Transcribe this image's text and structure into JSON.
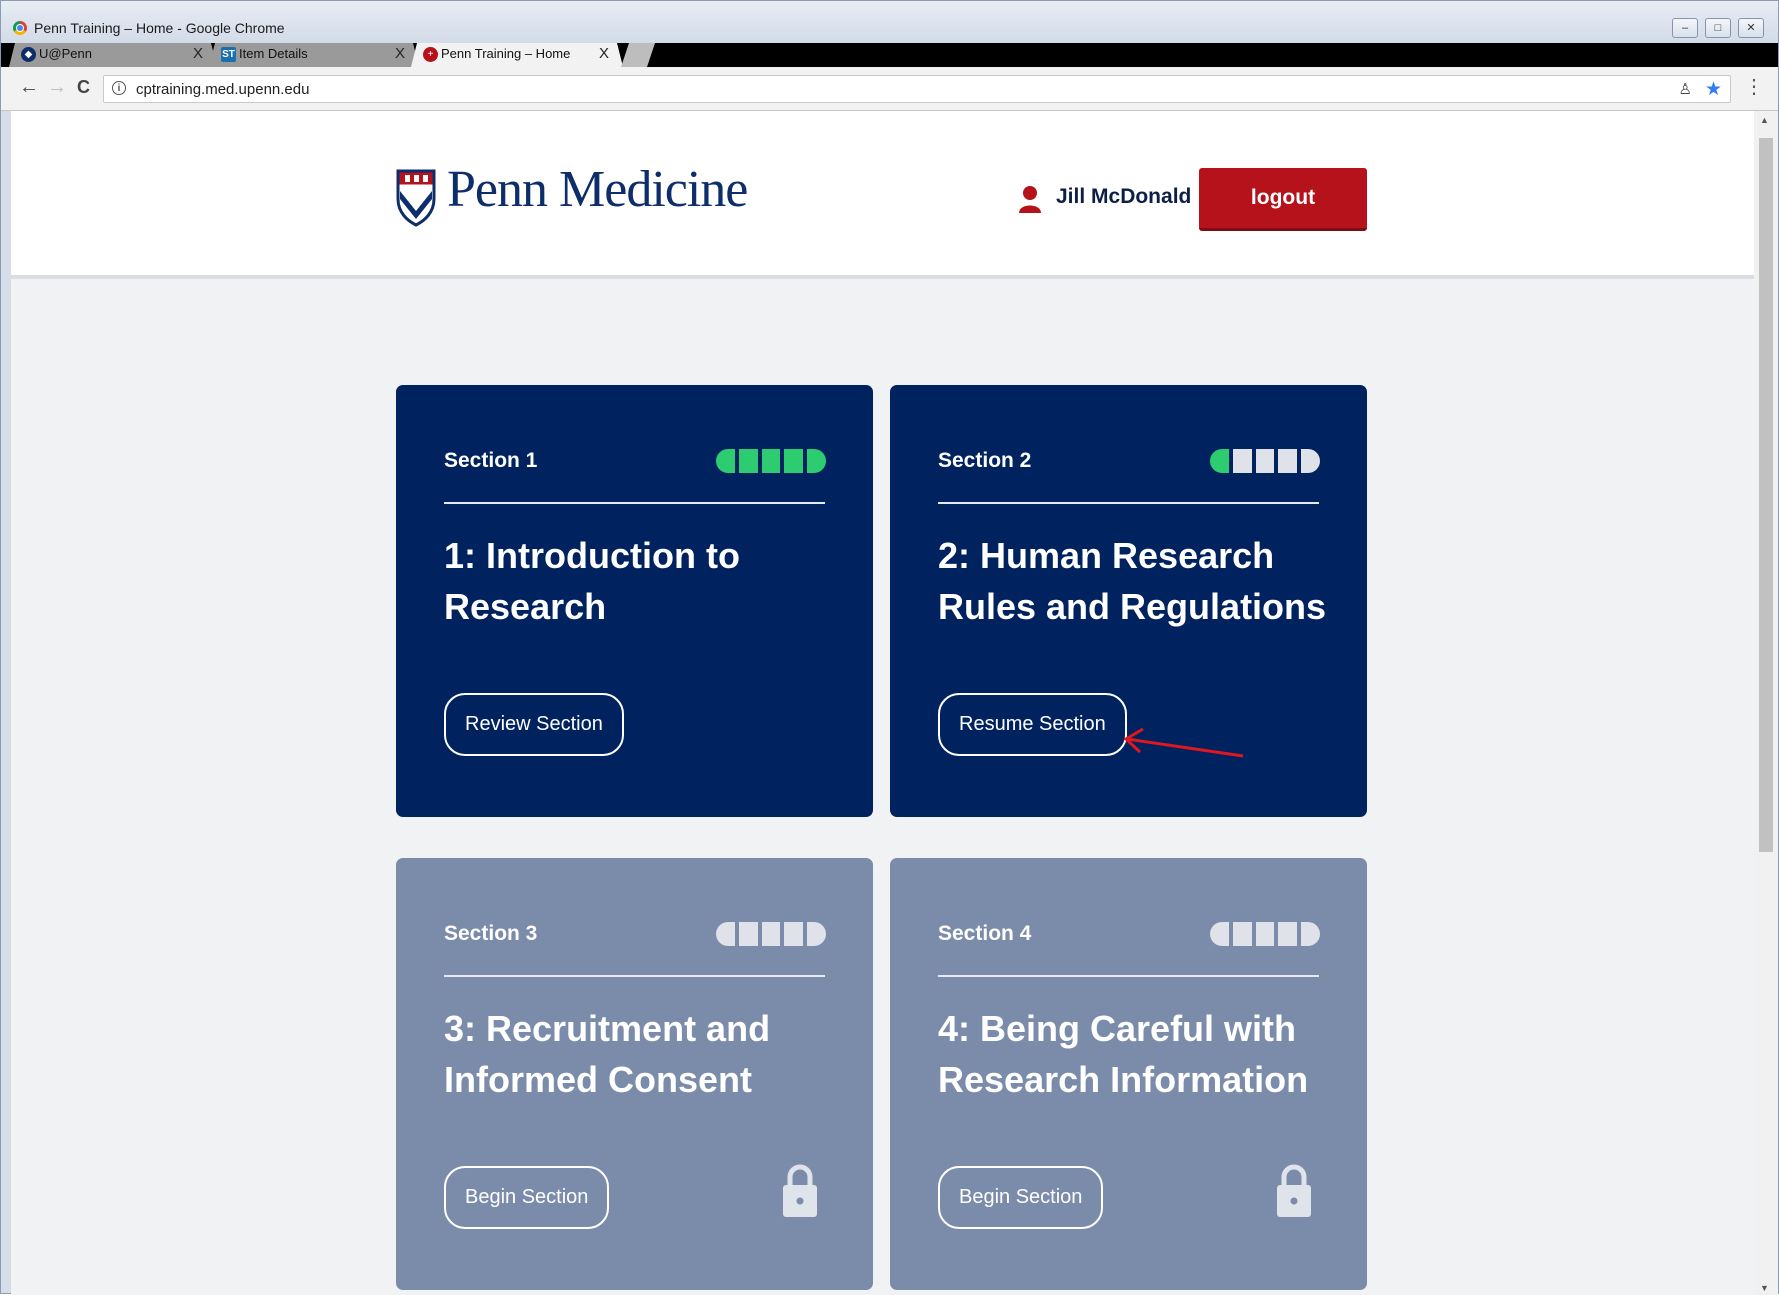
{
  "window": {
    "title": "Penn Training – Home - Google Chrome",
    "controls": {
      "minimize": "–",
      "maximize": "□",
      "close": "✕"
    }
  },
  "tabs": [
    {
      "label": "U@Penn",
      "close": "X",
      "icon": "penn-shield-icon"
    },
    {
      "label": "Item Details",
      "close": "X",
      "icon_text": "ST"
    },
    {
      "label": "Penn Training – Home",
      "close": "X",
      "icon": "plus-icon"
    }
  ],
  "toolbar": {
    "back": "←",
    "forward": "→",
    "reload": "C",
    "info": "i",
    "url": "cptraining.med.upenn.edu",
    "key": "♙",
    "star": "★",
    "menu": "⋮"
  },
  "header": {
    "brand": "Penn Medicine",
    "username": "Jill McDonald",
    "logout": "logout"
  },
  "sections": [
    {
      "label": "Section 1",
      "title": "1: Introduction to Research",
      "button": "Review Section",
      "progress_done": 5,
      "progress_total": 5,
      "locked": false
    },
    {
      "label": "Section 2",
      "title": "2: Human Research Rules and Regulations",
      "button": "Resume Section",
      "progress_done": 1,
      "progress_total": 5,
      "locked": false
    },
    {
      "label": "Section 3",
      "title": "3: Recruitment and Informed Consent",
      "button": "Begin Section",
      "progress_done": 0,
      "progress_total": 5,
      "locked": true
    },
    {
      "label": "Section 4",
      "title": "4: Being Careful with Research Information",
      "button": "Begin Section",
      "progress_done": 0,
      "progress_total": 5,
      "locked": true
    }
  ],
  "colors": {
    "card_active": "#00235f",
    "card_locked": "#7b8cab",
    "progress_done": "#2ecc71",
    "logout": "#b5121b",
    "brand": "#0d2d6b",
    "annotation_arrow": "#e0171d"
  },
  "scrollbar": {
    "up": "▲",
    "down": "▼"
  }
}
